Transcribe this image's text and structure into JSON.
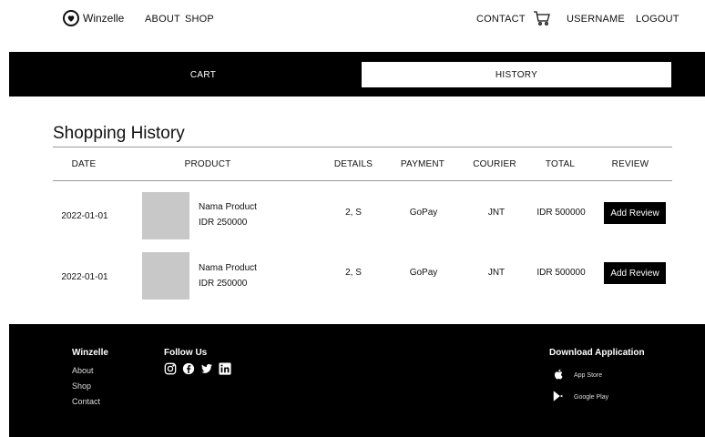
{
  "nav": {
    "brand": "Winzelle",
    "about": "ABOUT",
    "shop": "SHOP",
    "contact": "CONTACT",
    "username": "USERNAME",
    "logout": "LOGOUT"
  },
  "tabs": {
    "cart": "CART",
    "history": "HISTORY"
  },
  "history": {
    "title": "Shopping History",
    "columns": [
      "DATE",
      "PRODUCT",
      "DETAILS",
      "PAYMENT",
      "COURIER",
      "TOTAL",
      "REVIEW"
    ],
    "rows": [
      {
        "date": "2022-01-01",
        "product_name": "Nama Product",
        "product_price": "IDR 250000",
        "details": "2, S",
        "payment": "GoPay",
        "courier": "JNT",
        "total": "IDR 500000",
        "review_label": "Add Review"
      },
      {
        "date": "2022-01-01",
        "product_name": "Nama Product",
        "product_price": "IDR 250000",
        "details": "2, S",
        "payment": "GoPay",
        "courier": "JNT",
        "total": "IDR 500000",
        "review_label": "Add Review"
      }
    ]
  },
  "footer": {
    "brand": "Winzelle",
    "links": [
      "About",
      "Shop",
      "Contact"
    ],
    "follow_title": "Follow Us",
    "social_icons": [
      "instagram-icon",
      "facebook-icon",
      "twitter-icon",
      "linkedin-icon"
    ],
    "download_title": "Download Application",
    "app_store": "App Store",
    "google_play": "Google Play"
  },
  "colors": {
    "primary": "#000000",
    "background": "#ffffff",
    "placeholder": "#c8c8c8"
  }
}
